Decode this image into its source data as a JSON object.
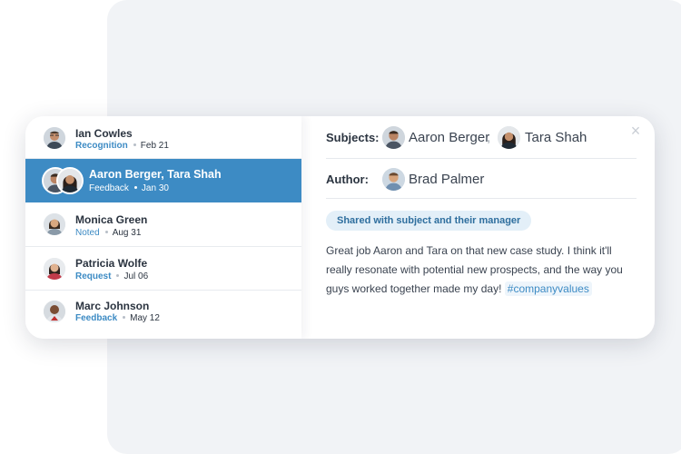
{
  "feed": {
    "items": [
      {
        "name": "Ian Cowles",
        "type": "Recognition",
        "date": "Feb 21",
        "avatar_icon": "man-glasses-avatar"
      },
      {
        "name": "Aaron Berger, Tara Shah",
        "type": "Feedback",
        "date": "Jan 30",
        "avatar_icon": "group-avatar"
      },
      {
        "name": "Monica Green",
        "type": "Noted",
        "date": "Aug 31",
        "avatar_icon": "woman-avatar"
      },
      {
        "name": "Patricia Wolfe",
        "type": "Request",
        "date": "Jul 06",
        "avatar_icon": "woman-avatar"
      },
      {
        "name": "Marc Johnson",
        "type": "Feedback",
        "date": "May 12",
        "avatar_icon": "man-avatar"
      }
    ]
  },
  "detail": {
    "subjects_label": "Subjects:",
    "subjects": [
      "Aaron Berger",
      "Tara Shah"
    ],
    "separator": ",",
    "author_label": "Author:",
    "author": "Brad Palmer",
    "visibility": "Shared with subject and their manager",
    "message": "Great job Aaron and Tara on that new case study. I think it'll really resonate with potential new prospects, and the way you guys worked together made my day!",
    "hashtag": "#companyvalues",
    "close_symbol": "×"
  },
  "colors": {
    "accent": "#3d8bc4",
    "selected_row": "#3d8bc4",
    "pill_bg": "#e3eff8",
    "text_dark": "#2b3440"
  }
}
